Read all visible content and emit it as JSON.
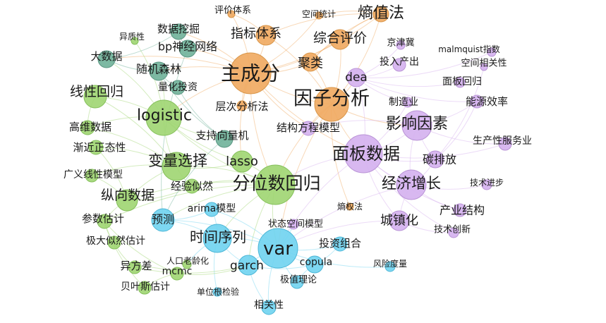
{
  "graph": {
    "colors": {
      "orange": "#f0a95f",
      "purple": "#d4b0ee",
      "green": "#9fd571",
      "teal": "#6fb199",
      "blue": "#6fd3f0",
      "stroke_orange": "#d8964a",
      "stroke_purple": "#b993d6",
      "stroke_green": "#84bf5a",
      "stroke_teal": "#5a9682",
      "stroke_blue": "#4cb6d6"
    },
    "nodes": [
      {
        "id": "zcf",
        "label": "主成分",
        "cluster": "orange",
        "weight": 10
      },
      {
        "id": "yzfx",
        "label": "因子分析",
        "cluster": "orange",
        "weight": 8
      },
      {
        "id": "szf",
        "label": "熵值法",
        "cluster": "orange",
        "weight": 4
      },
      {
        "id": "zbtx",
        "label": "指标体系",
        "cluster": "orange",
        "weight": 4
      },
      {
        "id": "zhpj",
        "label": "综合评价",
        "cluster": "orange",
        "weight": 4
      },
      {
        "id": "jl",
        "label": "聚类",
        "cluster": "orange",
        "weight": 4
      },
      {
        "id": "pjtx",
        "label": "评价体系",
        "cluster": "orange",
        "weight": 1
      },
      {
        "id": "kjtj",
        "label": "空间统计",
        "cluster": "orange",
        "weight": 1
      },
      {
        "id": "ccfx",
        "label": "层次分析法",
        "cluster": "orange",
        "weight": 1
      },
      {
        "id": "sqf",
        "label": "熵权法",
        "cluster": "orange",
        "weight": 1
      },
      {
        "id": "mbsj",
        "label": "面板数据",
        "cluster": "purple",
        "weight": 9
      },
      {
        "id": "yxys",
        "label": "影响因素",
        "cluster": "purple",
        "weight": 7
      },
      {
        "id": "jjzz",
        "label": "经济增长",
        "cluster": "purple",
        "weight": 7
      },
      {
        "id": "dea",
        "label": "dea",
        "cluster": "purple",
        "weight": 4
      },
      {
        "id": "czh",
        "label": "城镇化",
        "cluster": "purple",
        "weight": 3
      },
      {
        "id": "tpf",
        "label": "碳排放",
        "cluster": "purple",
        "weight": 3
      },
      {
        "id": "jgfc",
        "label": "结构方程模型",
        "cluster": "purple",
        "weight": 2
      },
      {
        "id": "jjj",
        "label": "京津冀",
        "cluster": "purple",
        "weight": 1
      },
      {
        "id": "malm",
        "label": "malmquist指数",
        "cluster": "purple",
        "weight": 1
      },
      {
        "id": "trcc",
        "label": "投入产出",
        "cluster": "purple",
        "weight": 2
      },
      {
        "id": "kjxg",
        "label": "空间相关性",
        "cluster": "purple",
        "weight": 1
      },
      {
        "id": "mbhg",
        "label": "面板回归",
        "cluster": "purple",
        "weight": 1
      },
      {
        "id": "zzy",
        "label": "制造业",
        "cluster": "purple",
        "weight": 1
      },
      {
        "id": "nyxl",
        "label": "能源效率",
        "cluster": "purple",
        "weight": 2
      },
      {
        "id": "scxfw",
        "label": "生产性服务业",
        "cluster": "purple",
        "weight": 2
      },
      {
        "id": "jsjb",
        "label": "技术进步",
        "cluster": "purple",
        "weight": 1
      },
      {
        "id": "cyjg",
        "label": "产业结构",
        "cluster": "purple",
        "weight": 2
      },
      {
        "id": "jscx",
        "label": "技术创新",
        "cluster": "purple",
        "weight": 1
      },
      {
        "id": "ztkj",
        "label": "状态空间模型",
        "cluster": "purple",
        "weight": 1
      },
      {
        "id": "logistic",
        "label": "logistic",
        "cluster": "green",
        "weight": 8
      },
      {
        "id": "fwshg",
        "label": "分位数回归",
        "cluster": "green",
        "weight": 9
      },
      {
        "id": "blxz",
        "label": "变量选择",
        "cluster": "green",
        "weight": 6
      },
      {
        "id": "lasso",
        "label": "lasso",
        "cluster": "green",
        "weight": 4
      },
      {
        "id": "xxhg",
        "label": "线性回归",
        "cluster": "green",
        "weight": 4
      },
      {
        "id": "zxsj",
        "label": "纵向数据",
        "cluster": "green",
        "weight": 4
      },
      {
        "id": "gwsj",
        "label": "高维数据",
        "cluster": "green",
        "weight": 2
      },
      {
        "id": "jjzt",
        "label": "渐近正态性",
        "cluster": "green",
        "weight": 2
      },
      {
        "id": "gyxx",
        "label": "广义线性模型",
        "cluster": "green",
        "weight": 2
      },
      {
        "id": "csgj",
        "label": "参数估计",
        "cluster": "green",
        "weight": 2
      },
      {
        "id": "jdsr",
        "label": "极大似然估计",
        "cluster": "green",
        "weight": 2
      },
      {
        "id": "jysr",
        "label": "经验似然",
        "cluster": "green",
        "weight": 2
      },
      {
        "id": "yfc",
        "label": "异方差",
        "cluster": "green",
        "weight": 2
      },
      {
        "id": "bysgj",
        "label": "贝叶斯估计",
        "cluster": "green",
        "weight": 2
      },
      {
        "id": "mcmc",
        "label": "mcmc",
        "cluster": "green",
        "weight": 2
      },
      {
        "id": "rklh",
        "label": "人口老龄化",
        "cluster": "green",
        "weight": 1
      },
      {
        "id": "yzx",
        "label": "异质性",
        "cluster": "green",
        "weight": 1
      },
      {
        "id": "dsj",
        "label": "大数据",
        "cluster": "teal",
        "weight": 3
      },
      {
        "id": "sjwj",
        "label": "数据挖掘",
        "cluster": "teal",
        "weight": 3
      },
      {
        "id": "bpsj",
        "label": "bp神经网络",
        "cluster": "teal",
        "weight": 3
      },
      {
        "id": "sjsl",
        "label": "随机森林",
        "cluster": "teal",
        "weight": 3
      },
      {
        "id": "lhtz",
        "label": "量化投资",
        "cluster": "teal",
        "weight": 2
      },
      {
        "id": "zcxl",
        "label": "支持向量机",
        "cluster": "teal",
        "weight": 3
      },
      {
        "id": "var",
        "label": "var",
        "cluster": "blue",
        "weight": 8
      },
      {
        "id": "sjxl",
        "label": "时间序列",
        "cluster": "blue",
        "weight": 6
      },
      {
        "id": "garch",
        "label": "garch",
        "cluster": "blue",
        "weight": 4
      },
      {
        "id": "yc",
        "label": "预测",
        "cluster": "blue",
        "weight": 4
      },
      {
        "id": "arima",
        "label": "arima模型",
        "cluster": "blue",
        "weight": 2
      },
      {
        "id": "copula",
        "label": "copula",
        "cluster": "blue",
        "weight": 3
      },
      {
        "id": "tzzh",
        "label": "投资组合",
        "cluster": "blue",
        "weight": 2
      },
      {
        "id": "fxdl",
        "label": "风险度量",
        "cluster": "blue",
        "weight": 1
      },
      {
        "id": "jzll",
        "label": "极值理论",
        "cluster": "blue",
        "weight": 1
      },
      {
        "id": "dwgjy",
        "label": "单位根检验",
        "cluster": "blue",
        "weight": 1
      },
      {
        "id": "xgx",
        "label": "相关性",
        "cluster": "blue",
        "weight": 2
      }
    ],
    "edges": [
      [
        "zcf",
        "yzfx"
      ],
      [
        "zcf",
        "szf"
      ],
      [
        "zcf",
        "zbtx"
      ],
      [
        "zcf",
        "zhpj"
      ],
      [
        "zcf",
        "jl"
      ],
      [
        "zcf",
        "pjtx"
      ],
      [
        "zcf",
        "kjtj"
      ],
      [
        "zcf",
        "ccfx"
      ],
      [
        "zcf",
        "logistic"
      ],
      [
        "zcf",
        "fwshg"
      ],
      [
        "zcf",
        "sjwj"
      ],
      [
        "zcf",
        "bpsj"
      ],
      [
        "zcf",
        "mbsj"
      ],
      [
        "zcf",
        "dsj"
      ],
      [
        "zcf",
        "sjsl"
      ],
      [
        "zcf",
        "lasso"
      ],
      [
        "zcf",
        "jgfc"
      ],
      [
        "yzfx",
        "zhpj"
      ],
      [
        "yzfx",
        "jl"
      ],
      [
        "yzfx",
        "dea"
      ],
      [
        "yzfx",
        "mbsj"
      ],
      [
        "yzfx",
        "szf"
      ],
      [
        "yzfx",
        "zbtx"
      ],
      [
        "yzfx",
        "jgfc"
      ],
      [
        "yzfx",
        "sqf"
      ],
      [
        "yzfx",
        "yxys"
      ],
      [
        "yzfx",
        "fwshg"
      ],
      [
        "yzfx",
        "var"
      ],
      [
        "szf",
        "zbtx"
      ],
      [
        "szf",
        "zhpj"
      ],
      [
        "szf",
        "kjtj"
      ],
      [
        "szf",
        "jl"
      ],
      [
        "zhpj",
        "jl"
      ],
      [
        "zbtx",
        "pjtx"
      ],
      [
        "mbsj",
        "yxys"
      ],
      [
        "mbsj",
        "jjzz"
      ],
      [
        "mbsj",
        "tpf"
      ],
      [
        "mbsj",
        "czh"
      ],
      [
        "mbsj",
        "dea"
      ],
      [
        "mbsj",
        "fwshg"
      ],
      [
        "mbsj",
        "var"
      ],
      [
        "mbsj",
        "cyjg"
      ],
      [
        "mbsj",
        "zzy"
      ],
      [
        "mbsj",
        "jscx"
      ],
      [
        "mbsj",
        "scxfw"
      ],
      [
        "yxys",
        "jjzz"
      ],
      [
        "yxys",
        "tpf"
      ],
      [
        "yxys",
        "nyxl"
      ],
      [
        "yxys",
        "jgfc"
      ],
      [
        "yxys",
        "scxfw"
      ],
      [
        "jjzz",
        "czh"
      ],
      [
        "jjzz",
        "cyjg"
      ],
      [
        "jjzz",
        "jsjb"
      ],
      [
        "jjzz",
        "var"
      ],
      [
        "jjzz",
        "tpf"
      ],
      [
        "dea",
        "trcc"
      ],
      [
        "dea",
        "malm"
      ],
      [
        "dea",
        "jjj"
      ],
      [
        "dea",
        "nyxl"
      ],
      [
        "dea",
        "mbhg"
      ],
      [
        "dea",
        "zzy"
      ],
      [
        "czh",
        "jscx"
      ],
      [
        "czh",
        "var"
      ],
      [
        "tpf",
        "kjxg"
      ],
      [
        "tpf",
        "nyxl"
      ],
      [
        "logistic",
        "blxz"
      ],
      [
        "logistic",
        "lasso"
      ],
      [
        "logistic",
        "xxhg"
      ],
      [
        "logistic",
        "gwsj"
      ],
      [
        "logistic",
        "zcxl"
      ],
      [
        "logistic",
        "sjsl"
      ],
      [
        "logistic",
        "dsj"
      ],
      [
        "logistic",
        "yzx"
      ],
      [
        "logistic",
        "fwshg"
      ],
      [
        "fwshg",
        "blxz"
      ],
      [
        "fwshg",
        "lasso"
      ],
      [
        "fwshg",
        "zxsj"
      ],
      [
        "fwshg",
        "jysr"
      ],
      [
        "fwshg",
        "var"
      ],
      [
        "fwshg",
        "sjxl"
      ],
      [
        "fwshg",
        "garch"
      ],
      [
        "fwshg",
        "csgj"
      ],
      [
        "fwshg",
        "yc"
      ],
      [
        "blxz",
        "lasso"
      ],
      [
        "blxz",
        "gwsj"
      ],
      [
        "blxz",
        "jjzt"
      ],
      [
        "blxz",
        "zxsj"
      ],
      [
        "blxz",
        "gyxx"
      ],
      [
        "blxz",
        "jysr"
      ],
      [
        "blxz",
        "xxhg"
      ],
      [
        "zxsj",
        "jjzt"
      ],
      [
        "zxsj",
        "csgj"
      ],
      [
        "zxsj",
        "jysr"
      ],
      [
        "zxsj",
        "gyxx"
      ],
      [
        "csgj",
        "jdsr"
      ],
      [
        "csgj",
        "mcmc"
      ],
      [
        "csgj",
        "bysgj"
      ],
      [
        "jdsr",
        "yfc"
      ],
      [
        "mcmc",
        "bysgj"
      ],
      [
        "mcmc",
        "yfc"
      ],
      [
        "xxhg",
        "gwsj"
      ],
      [
        "dsj",
        "sjwj"
      ],
      [
        "dsj",
        "sjsl"
      ],
      [
        "sjwj",
        "bpsj"
      ],
      [
        "sjsl",
        "lhtz"
      ],
      [
        "sjsl",
        "zcxl"
      ],
      [
        "bpsj",
        "yc"
      ],
      [
        "zcxl",
        "yc"
      ],
      [
        "lhtz",
        "zcxl"
      ],
      [
        "var",
        "sjxl"
      ],
      [
        "var",
        "garch"
      ],
      [
        "var",
        "copula"
      ],
      [
        "var",
        "tzzh"
      ],
      [
        "var",
        "fxdl"
      ],
      [
        "var",
        "jzll"
      ],
      [
        "var",
        "xgx"
      ],
      [
        "var",
        "ztkj"
      ],
      [
        "var",
        "yc"
      ],
      [
        "var",
        "arima"
      ],
      [
        "sjxl",
        "garch"
      ],
      [
        "sjxl",
        "yc"
      ],
      [
        "sjxl",
        "arima"
      ],
      [
        "sjxl",
        "dwgjy"
      ],
      [
        "sjxl",
        "rklh"
      ],
      [
        "garch",
        "copula"
      ],
      [
        "garch",
        "xgx"
      ],
      [
        "copula",
        "tzzh"
      ],
      [
        "copula",
        "jzll"
      ],
      [
        "yc",
        "arima"
      ],
      [
        "mcmc",
        "garch"
      ],
      [
        "yfc",
        "garch"
      ]
    ]
  }
}
